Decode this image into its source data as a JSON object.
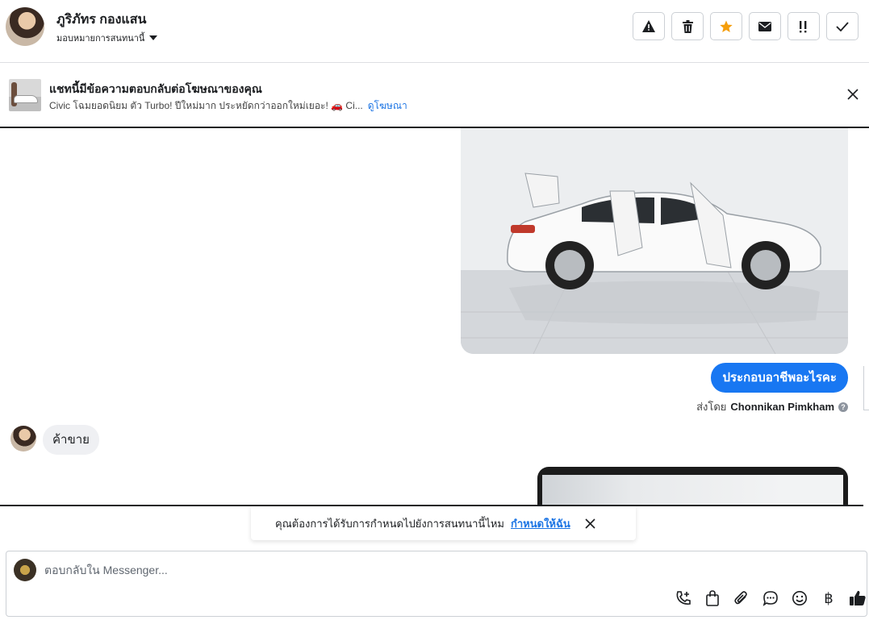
{
  "header": {
    "contact_name": "ภูริภัทร กองแสน",
    "assign_label": "มอบหมายการสนทนานี้",
    "actions": [
      {
        "icon": "warning-icon"
      },
      {
        "icon": "trash-icon"
      },
      {
        "icon": "star-icon",
        "color": "#f59e0b"
      },
      {
        "icon": "envelope-icon"
      },
      {
        "icon": "follow-up-icon"
      },
      {
        "icon": "check-icon"
      }
    ]
  },
  "ad": {
    "title": "แชทนี้มีข้อความตอบกลับต่อโฆษณาของคุณ",
    "text": "Civic โฉมยอดนิยม ตัว Turbo! ปีใหม่มาก ประหยัดกว่าออกใหม่เยอะ! 🚗 Ci...",
    "link": "ดูโฆษณา"
  },
  "messages": {
    "outgoing_text": "ประกอบอาชีพอะไรคะ",
    "sent_by_prefix": "ส่งโดย",
    "sent_by_name": "Chonnikan Pimkham",
    "incoming_text": "ค้าขาย"
  },
  "toast": {
    "text": "คุณต้องการได้รับการกำหนดไปยังการสนทนานี้ไหม",
    "link": "กำหนดให้ฉัน"
  },
  "composer": {
    "placeholder": "ตอบกลับใน Messenger...",
    "tools": [
      "phone-add-icon",
      "bag-icon",
      "paperclip-icon",
      "saved-reply-icon",
      "emoji-icon",
      "baht-icon",
      "thumbs-up-icon"
    ],
    "baht_symbol": "฿"
  },
  "colors": {
    "accent": "#1877f2",
    "link": "#1b74e4",
    "bubble_in": "#eff0f3"
  }
}
